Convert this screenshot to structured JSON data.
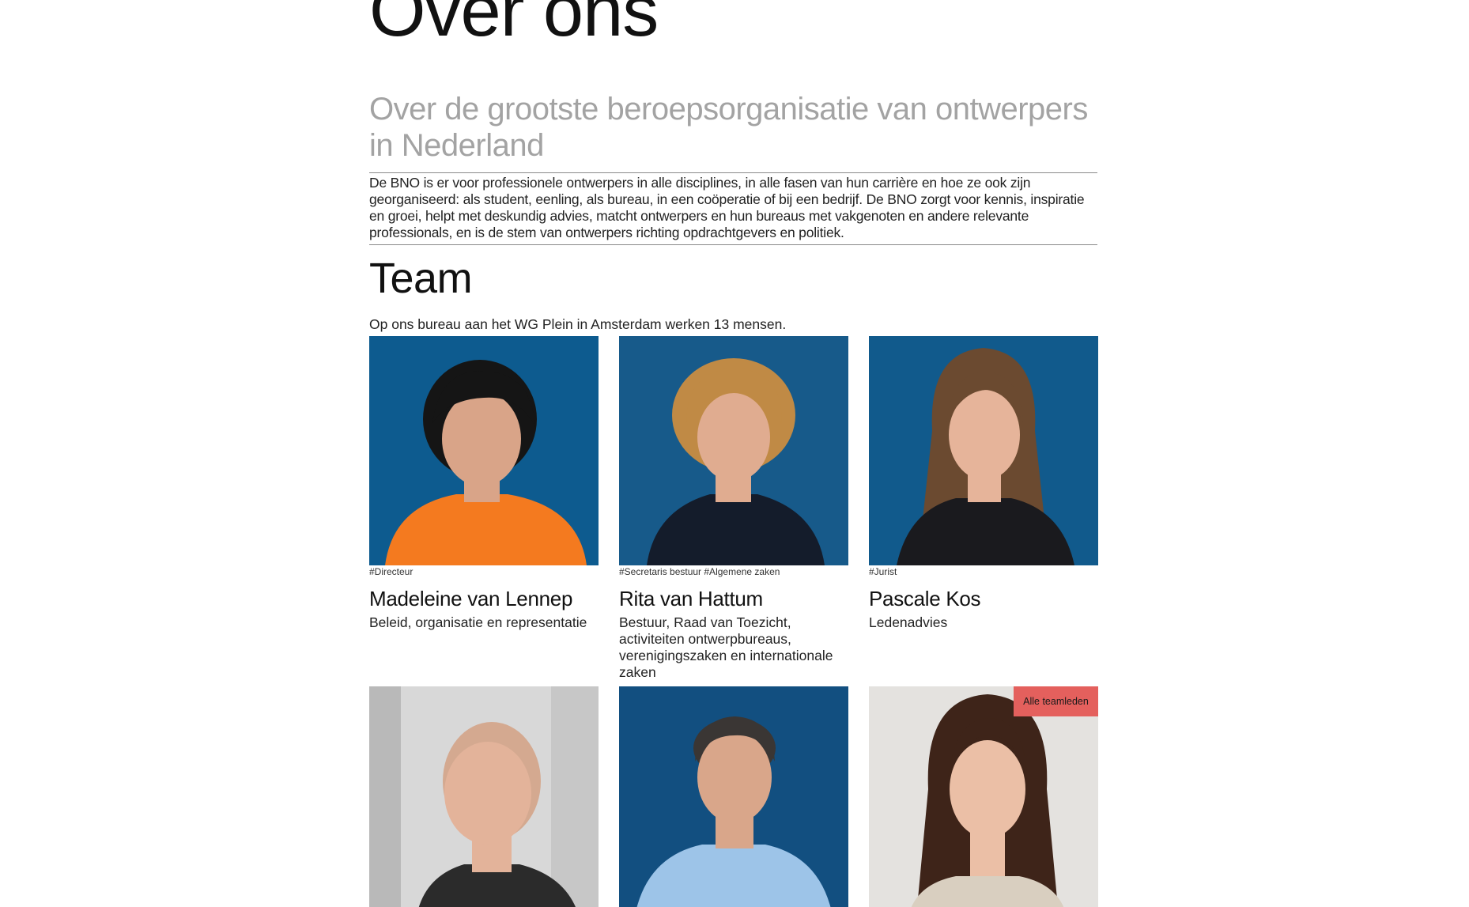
{
  "page": {
    "title": "Over ons",
    "subtitle": "Over de grootste beroepsorganisatie van ontwerpers in Nederland",
    "intro": "De BNO is er voor professionele ontwerpers in alle disciplines, in alle fasen van hun carrière en hoe ze ook zijn georganiseerd: als student, eenling, als bureau, in een coöperatie of bij een bedrijf. De BNO zorgt voor kennis, inspiratie en groei, helpt met deskundig advies, matcht ontwerpers en hun bureaus met vakgenoten en andere relevante professionals, en is de stem van ontwerpers richting opdrachtgevers en politiek."
  },
  "team": {
    "heading": "Team",
    "intro": "Op ons bureau aan het WG Plein in Amsterdam werken 13 mensen.",
    "all_button_label": "Alle teamleden",
    "members": [
      {
        "tags": "#Directeur",
        "name": "Madeleine van Lennep",
        "role": "Beleid, organisatie en representatie",
        "photo_bg": "#0d5b8f",
        "shirt": "#f47a1f",
        "hair": "#151515",
        "skin": "#d9a488"
      },
      {
        "tags": "#Secretaris bestuur #Algemene zaken",
        "name": "Rita van Hattum",
        "role": "Bestuur, Raad van Toezicht, activiteiten ontwerpbureaus, verenigingszaken en internationale zaken",
        "photo_bg": "#175a8a",
        "shirt": "#141c2b",
        "hair": "#c08a45",
        "skin": "#e0ac90"
      },
      {
        "tags": "#Jurist",
        "name": "Pascale Kos",
        "role": "Ledenadvies",
        "photo_bg": "#115a8c",
        "shirt": "#1a1a1e",
        "hair": "#6b4a30",
        "skin": "#e6b49a"
      },
      {
        "tags": "",
        "name": "",
        "role": "",
        "photo_bg": "#d8d8d8",
        "shirt": "#2b2b2b",
        "hair": "#d4a990",
        "skin": "#e3b39a"
      },
      {
        "tags": "",
        "name": "",
        "role": "",
        "photo_bg": "#124f80",
        "shirt": "#9dc4e8",
        "hair": "#3a3634",
        "skin": "#d9a68a"
      },
      {
        "tags": "",
        "name": "",
        "role": "",
        "photo_bg": "#e4e2df",
        "shirt": "#d9cfc0",
        "hair": "#3e2419",
        "skin": "#ebbfa6"
      }
    ]
  }
}
